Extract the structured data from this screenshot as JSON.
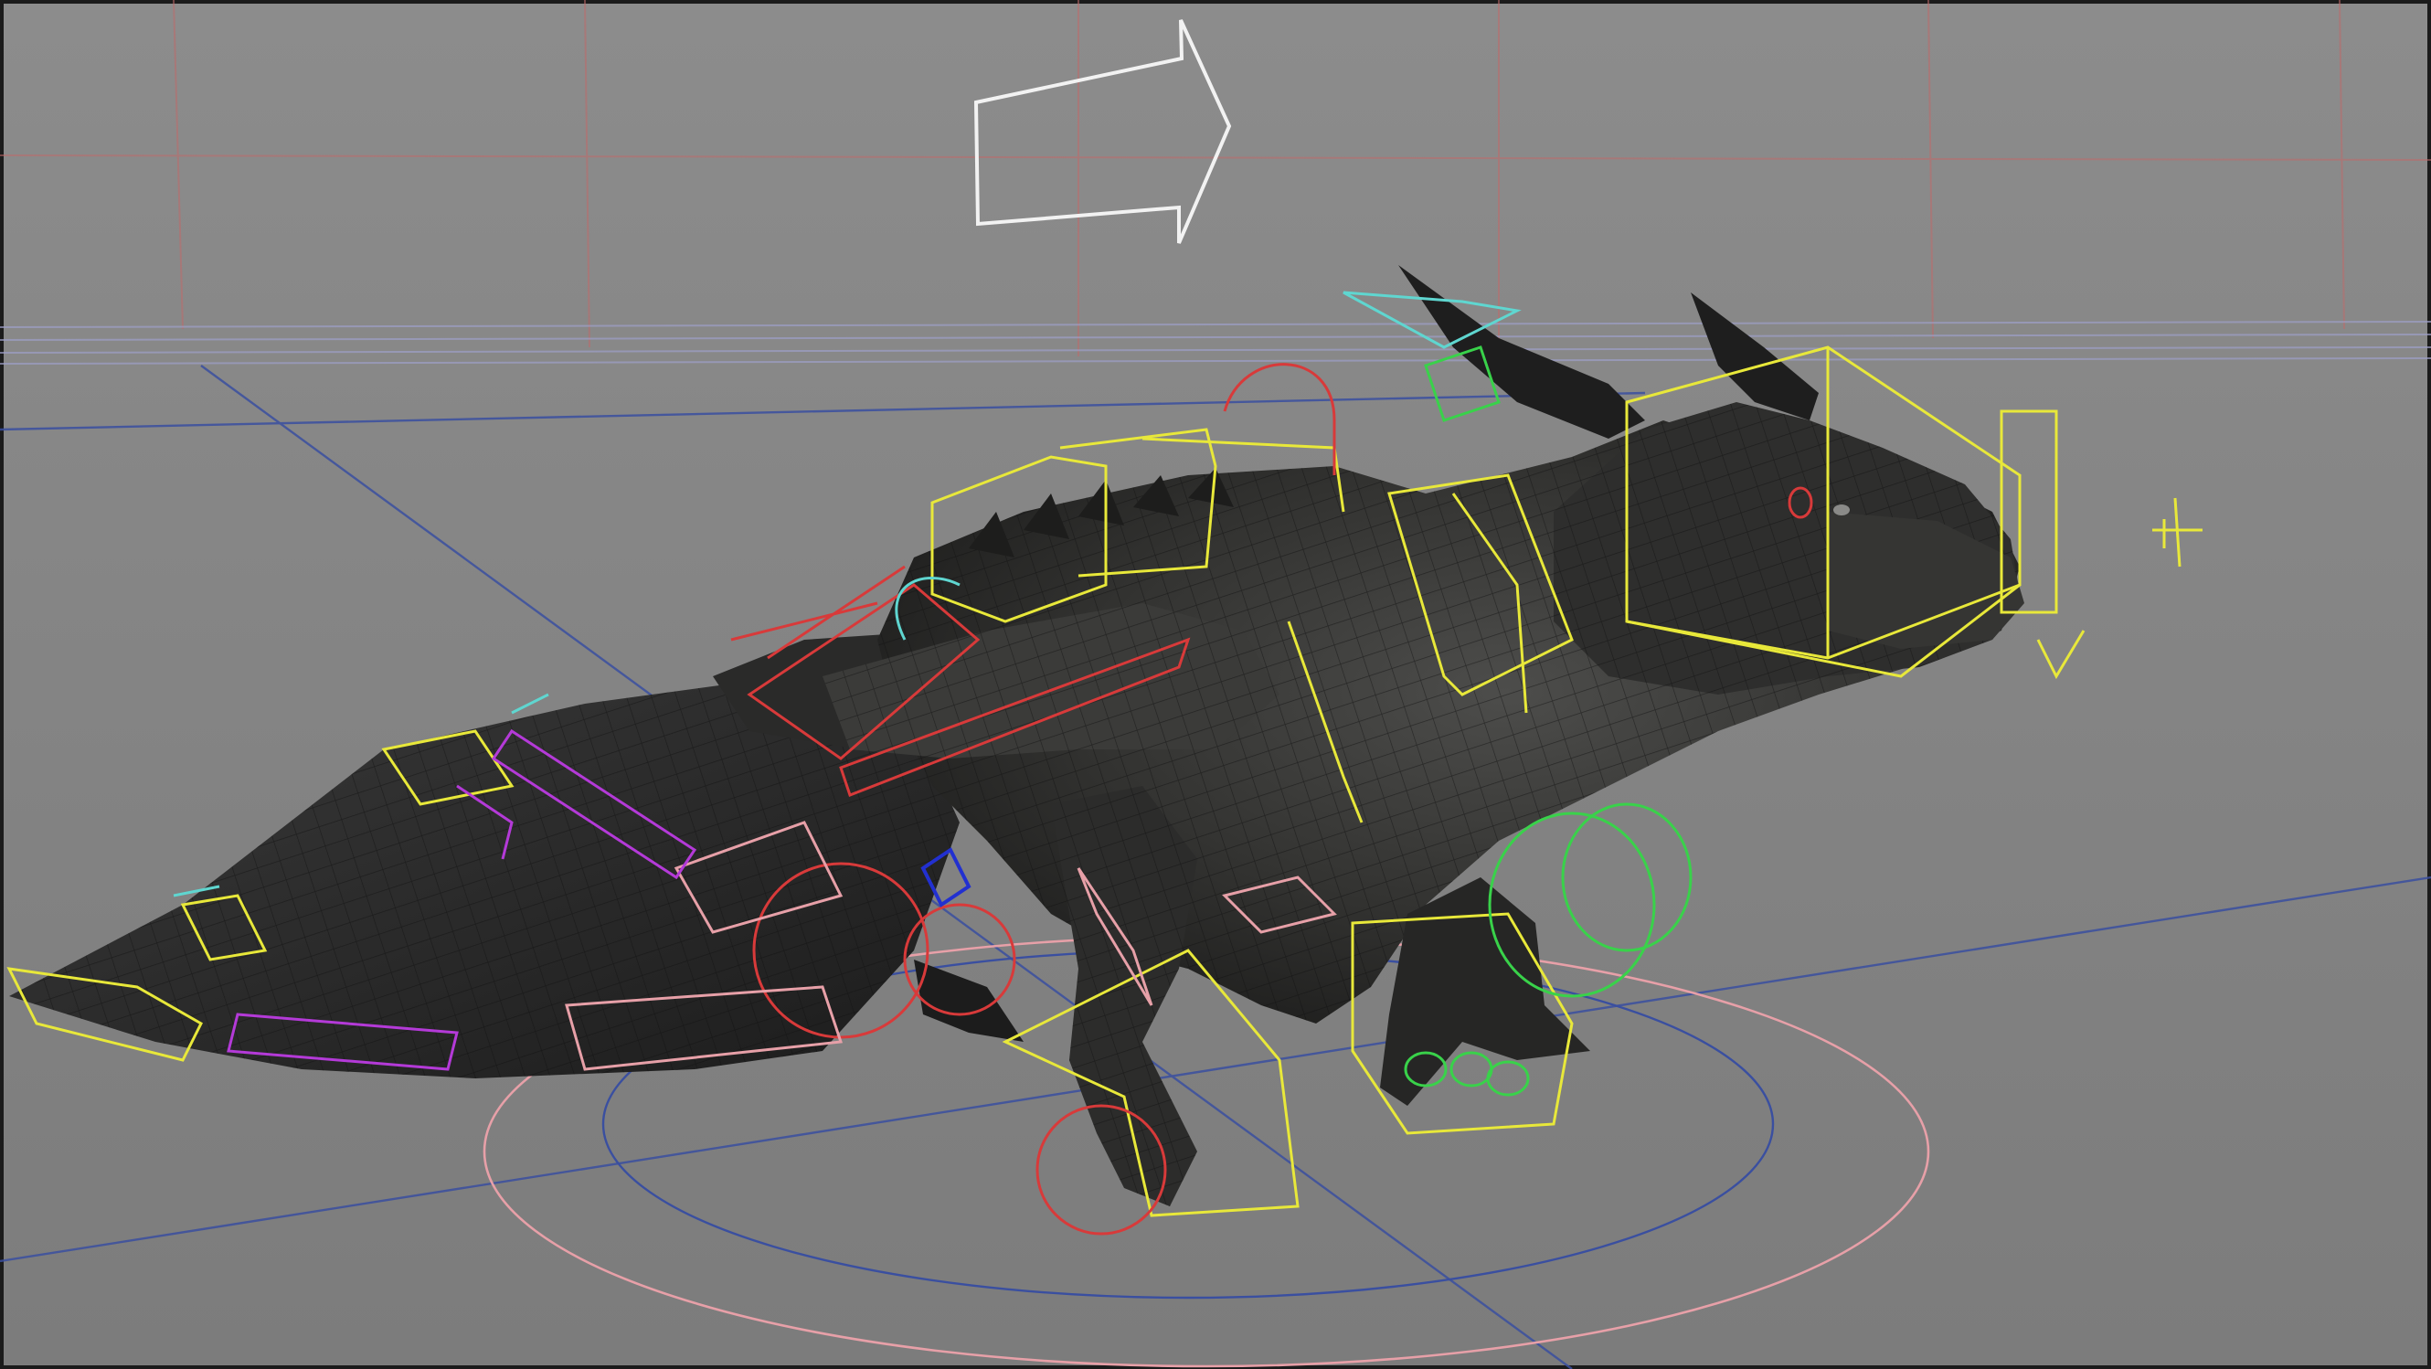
{
  "app": {
    "viewport_name": "",
    "shading": "wireframe-on-shaded"
  },
  "colors": {
    "background_top": "#8c8c8c",
    "background_bottom": "#7d7d7d",
    "grid": "#c06a6a",
    "floor_axis": "#3a4fa0",
    "move_arrow": "#f2f2f2",
    "rig_yellow": "#e8e83a",
    "rig_red": "#d83a3a",
    "rig_pink": "#e7a0a8",
    "rig_green": "#39d24a",
    "rig_magenta": "#b43ad8",
    "rig_cyan": "#5fd6d0",
    "model_dark": "#2b2b2b",
    "model_mid": "#4a4a4a"
  },
  "icons": {
    "move_direction": "right-arrow-outline-icon",
    "locator": "crosshair-locator-icon",
    "root_control": "circle-root-control-icon"
  },
  "scene": {
    "model": "dragon",
    "rig_controls_visible": true
  }
}
